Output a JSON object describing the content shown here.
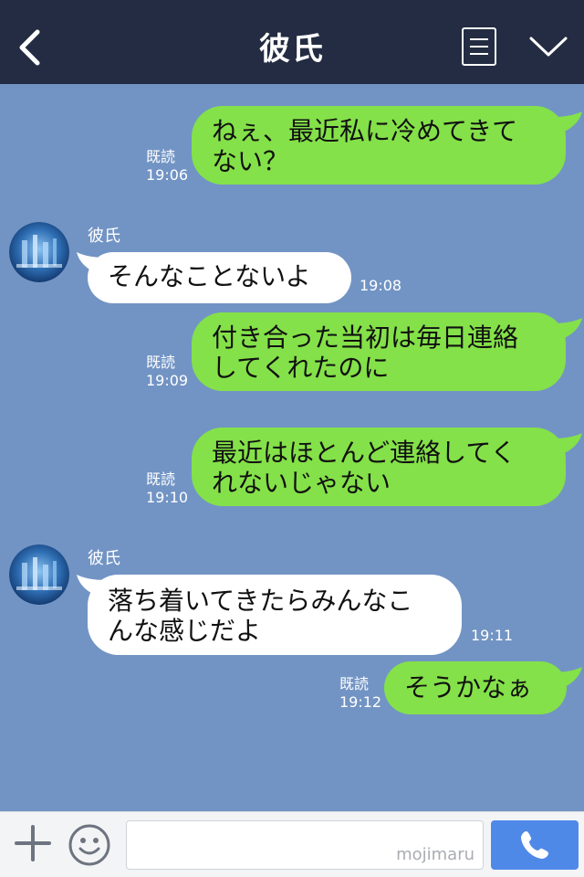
{
  "header": {
    "title": "彼氏",
    "icons": {
      "back": "chevron-left-icon",
      "menu": "menu-lines-icon",
      "collapse": "chevron-down-icon"
    },
    "background": "#232c42"
  },
  "chat": {
    "background": "#7294c4",
    "colors": {
      "sent": "#84e149",
      "received": "#ffffff"
    },
    "messages": [
      {
        "side": "right",
        "text": "ねぇ、最近私に冷めてきて\nない？",
        "read": "既読",
        "time": "19:06"
      },
      {
        "side": "left",
        "sender": "彼氏",
        "text": "そんなことないよ",
        "time": "19:08"
      },
      {
        "side": "right",
        "text": "付き合った当初は毎日連絡\nしてくれたのに",
        "read": "既読",
        "time": "19:09"
      },
      {
        "side": "right",
        "text": "最近はほとんど連絡してく\nれないじゃない",
        "read": "既読",
        "time": "19:10"
      },
      {
        "side": "left",
        "sender": "彼氏",
        "text": "落ち着いてきたらみんなこ\nんな感じだよ",
        "time": "19:11"
      },
      {
        "side": "right",
        "text": "そうかなぁ",
        "read": "既読",
        "time": "19:12"
      }
    ]
  },
  "input": {
    "value": "",
    "watermark": "mojimaru",
    "icons": {
      "plus": "plus-icon",
      "emoji": "smiley-icon",
      "call": "phone-icon"
    },
    "call_color": "#4f89e8"
  }
}
